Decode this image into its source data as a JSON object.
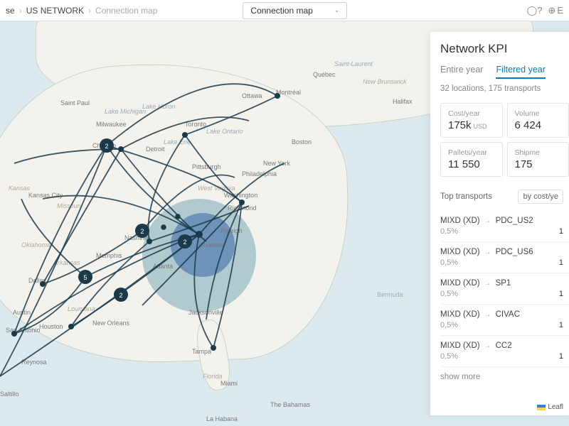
{
  "breadcrumb": {
    "item0": "se",
    "item1": "US NETWORK",
    "item2": "Connection map"
  },
  "selector": {
    "value": "Connection map"
  },
  "topbar": {
    "lang_letter": "E"
  },
  "map_cities": {
    "saintpaul": "Saint Paul",
    "milwaukee": "Milwaukee",
    "chicago": "Chicago",
    "kansascity": "Kansas City",
    "oklahoma": "Oklahoma",
    "dallas": "Dallas",
    "austin": "Austin",
    "sanantonio": "San Antonio",
    "reynosa": "Reynosa",
    "saltillo": "Saltillo",
    "atlanta": "Atlanta",
    "jacksonville": "Jacksonville",
    "houston": "Houston",
    "richmond": "Richmond",
    "washington": "Washington",
    "philadelphia": "Philadelphia",
    "newyork": "New York",
    "boston": "Boston",
    "toronto": "Toronto",
    "ottawa": "Ottawa",
    "montreal": "Montréal",
    "quebec": "Québec",
    "halifax": "Halifax",
    "detroit": "Detroit",
    "pittsburgh": "Pittsburgh",
    "nashville": "Nashville",
    "charlotte": "Charlotte",
    "raleigh": "Raleigh",
    "memphis": "Memphis",
    "neworleans": "New Orleans",
    "tampa": "Tampa",
    "miami": "Miami",
    "lahabana": "La Habana",
    "bahamas": "The Bahamas",
    "bermuda": "Bermuda",
    "kansas": "Kansas",
    "missouri": "Missouri",
    "arkansas": "Arkansas",
    "louisiana": "Louisiana",
    "lakemichigan": "Lake Michigan",
    "lakehuron": "Lake Huron",
    "lakeerie": "Lake Erie",
    "lakeontario": "Lake Ontario",
    "westvirginia": "West Virginia",
    "newbrunswick": "New Brunswick",
    "stlawrence": "Saint-Laurent",
    "florida": "Florida"
  },
  "clusters": {
    "a": "2",
    "b": "5",
    "c": "2",
    "d": "2",
    "e": "2"
  },
  "kpi": {
    "title": "Network KPI",
    "tabs": {
      "entire": "Entire year",
      "filtered": "Filtered year"
    },
    "subtitle": "32 locations, 175 transports",
    "cards": {
      "cost": {
        "label": "Cost/year",
        "value": "175k",
        "unit": "USD"
      },
      "volume": {
        "label": "Volume",
        "value": "6 424"
      },
      "pallets": {
        "label": "Pallets/year",
        "value": "11 550"
      },
      "shipments": {
        "label": "Shipme",
        "value": "175"
      }
    },
    "top_label": "Top transports",
    "top_sort": "by cost/ye",
    "transports": [
      {
        "from": "MIXD (XD)",
        "to": "PDC_US2",
        "pct": "0,5%",
        "rank": "1"
      },
      {
        "from": "MIXD (XD)",
        "to": "PDC_US6",
        "pct": "0,5%",
        "rank": "1"
      },
      {
        "from": "MIXD (XD)",
        "to": "SP1",
        "pct": "0,5%",
        "rank": "1"
      },
      {
        "from": "MIXD (XD)",
        "to": "CIVAC",
        "pct": "0,5%",
        "rank": "1"
      },
      {
        "from": "MIXD (XD)",
        "to": "CC2",
        "pct": "0,5%",
        "rank": "1"
      }
    ],
    "show_more": "show more"
  },
  "leaflet": "Leafl"
}
